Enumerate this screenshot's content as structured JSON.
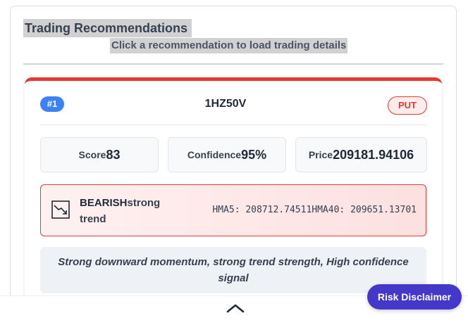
{
  "panel": {
    "title": "Trading Recommendations",
    "subtitle": "Click a recommendation to load trading details"
  },
  "recommendation": {
    "rank": "#1",
    "symbol": "1HZ50V",
    "direction": "PUT",
    "accent_color": "#e53935",
    "metrics": {
      "score_label": "Score",
      "score_value": "83",
      "confidence_label": "Confidence",
      "confidence_value": "95%",
      "price_label": "Price",
      "price_value": "209181.94106"
    },
    "trend": {
      "icon": "trending-down-icon",
      "direction": "BEARISH",
      "strength": "strong trend",
      "hma5": "HMA5: 208712.74511",
      "hma40": "HMA40: 209651.13701"
    },
    "reason": "Strong downward momentum, strong trend strength, High confidence signal"
  },
  "footer": {
    "toggle_icon": "chevron-up-icon",
    "risk_disclaimer_label": "Risk Disclaimer",
    "risk_button_color": "#4338ca"
  }
}
